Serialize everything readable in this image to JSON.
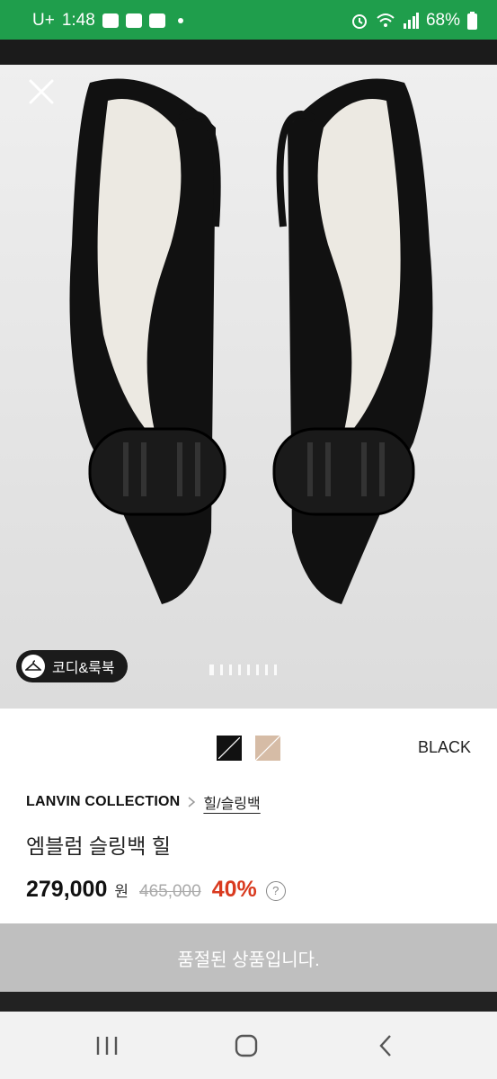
{
  "status_bar": {
    "carrier": "U+",
    "time": "1:48",
    "notification_labels": [
      "TALK",
      "KEY"
    ],
    "battery": "68%"
  },
  "hero": {
    "lookbook_label": "코디&룩북",
    "image_count": 8,
    "active_image": 1,
    "icons": [
      "close-icon",
      "hanger-icon"
    ]
  },
  "product": {
    "swatches": [
      {
        "name": "black",
        "color": "#111111"
      },
      {
        "name": "beige",
        "color": "#d6bca6"
      }
    ],
    "selected_color": "BLACK",
    "brand": "LANVIN COLLECTION",
    "category": "힐/슬링백",
    "name": "엠블럼 슬링백 힐",
    "price": "279,000",
    "currency": "원",
    "original_price": "465,000",
    "discount": "40%",
    "help_glyph": "?"
  },
  "cta": {
    "label": "품절된 상품입니다."
  },
  "navbar": {
    "icons": [
      "recent-apps-icon",
      "home-icon",
      "back-icon"
    ]
  },
  "colors": {
    "status_green": "#1f9e4c",
    "discount_red": "#d93a1f",
    "soldout_gray": "#bfbfbf"
  }
}
